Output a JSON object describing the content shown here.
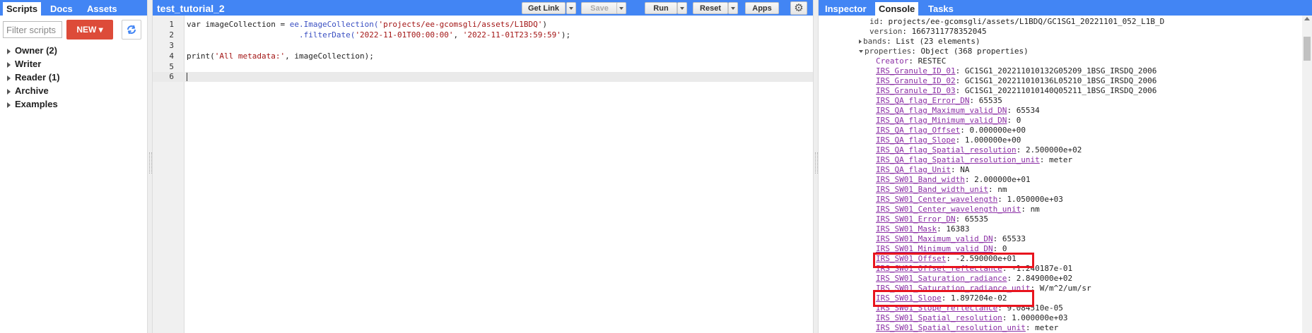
{
  "left_panel": {
    "tabs": [
      "Scripts",
      "Docs",
      "Assets"
    ],
    "filter_placeholder": "Filter scripts",
    "new_label": "NEW ▾",
    "tree": [
      "Owner (2)",
      "Writer",
      "Reader (1)",
      "Archive",
      "Examples"
    ]
  },
  "editor": {
    "title": "test_tutorial_2",
    "buttons": {
      "get_link": "Get Link",
      "save": "Save",
      "run": "Run",
      "reset": "Reset",
      "apps": "Apps"
    },
    "line_numbers": [
      "1",
      "2",
      "3",
      "4",
      "5",
      "6"
    ],
    "code": {
      "l1_a": "var imageCollection = ",
      "l1_b": "ee.ImageCollection(",
      "l1_c": "'projects/ee-gcomsgli/assets/L1BDQ'",
      "l1_d": ")",
      "l2_a": "                        ",
      "l2_b": ".filterDate(",
      "l2_c": "'2022-11-01T00:00:00'",
      "l2_d": ", ",
      "l2_e": "'2022-11-01T23:59:59'",
      "l2_f": ");",
      "l4_a": "print(",
      "l4_b": "'All metadata:'",
      "l4_c": ", imageCollection);"
    }
  },
  "console": {
    "tabs": [
      "Inspector",
      "Console",
      "Tasks"
    ],
    "header": [
      {
        "key": "id",
        "value": "projects/ee-gcomsgli/assets/L1BDQ/GC1SG1_20221101_052_L1B_D"
      },
      {
        "key": "version",
        "value": "1667311778352045"
      },
      {
        "key": "bands",
        "value": "List (23 elements)"
      },
      {
        "key": "properties",
        "value": "Object (368 properties)"
      }
    ],
    "properties": [
      {
        "key": "Creator",
        "value": "RESTEC"
      },
      {
        "key": "IRS_Granule_ID_01",
        "value": "GC1SG1_202211010132G05209_1BSG_IRSDQ_2006"
      },
      {
        "key": "IRS_Granule_ID_02",
        "value": "GC1SG1_202211010136L05210_1BSG_IRSDQ_2006"
      },
      {
        "key": "IRS_Granule_ID_03",
        "value": "GC1SG1_202211010140Q05211_1BSG_IRSDQ_2006"
      },
      {
        "key": "IRS_QA_flag_Error_DN",
        "value": "65535"
      },
      {
        "key": "IRS_QA_flag_Maximum_valid_DN",
        "value": "65534"
      },
      {
        "key": "IRS_QA_flag_Minimum_valid_DN",
        "value": "0"
      },
      {
        "key": "IRS_QA_flag_Offset",
        "value": "0.000000e+00"
      },
      {
        "key": "IRS_QA_flag_Slope",
        "value": "1.000000e+00"
      },
      {
        "key": "IRS_QA_flag_Spatial_resolution",
        "value": "2.500000e+02"
      },
      {
        "key": "IRS_QA_flag_Spatial_resolution_unit",
        "value": "meter"
      },
      {
        "key": "IRS_QA_flag_Unit",
        "value": "NA"
      },
      {
        "key": "IRS_SW01_Band_width",
        "value": "2.000000e+01"
      },
      {
        "key": "IRS_SW01_Band_width_unit",
        "value": "nm"
      },
      {
        "key": "IRS_SW01_Center_wavelength",
        "value": "1.050000e+03"
      },
      {
        "key": "IRS_SW01_Center_wavelength_unit",
        "value": "nm"
      },
      {
        "key": "IRS_SW01_Error_DN",
        "value": "65535"
      },
      {
        "key": "IRS_SW01_Mask",
        "value": "16383"
      },
      {
        "key": "IRS_SW01_Maximum_valid_DN",
        "value": "65533"
      },
      {
        "key": "IRS_SW01_Minimum_valid_DN",
        "value": "0"
      },
      {
        "key": "IRS_SW01_Offset",
        "value": "-2.590000e+01"
      },
      {
        "key": "IRS_SW01_Offset_reflectance",
        "value": "-1.240187e-01"
      },
      {
        "key": "IRS_SW01_Saturation_radiance",
        "value": "2.849000e+02"
      },
      {
        "key": "IRS_SW01_Saturation_radiance_unit",
        "value": "W/m^2/um/sr"
      },
      {
        "key": "IRS_SW01_Slope",
        "value": "1.897204e-02"
      },
      {
        "key": "IRS_SW01_Slope_reflectance",
        "value": "9.084510e-05"
      },
      {
        "key": "IRS_SW01_Spatial_resolution",
        "value": "1.000000e+03"
      },
      {
        "key": "IRS_SW01_Spatial_resolution_unit",
        "value": "meter"
      }
    ]
  },
  "colors": {
    "header_blue": "#4285f4",
    "new_red": "#dd4b39",
    "highlight_red": "#e8141e",
    "property_key": "#8b2fa5"
  }
}
